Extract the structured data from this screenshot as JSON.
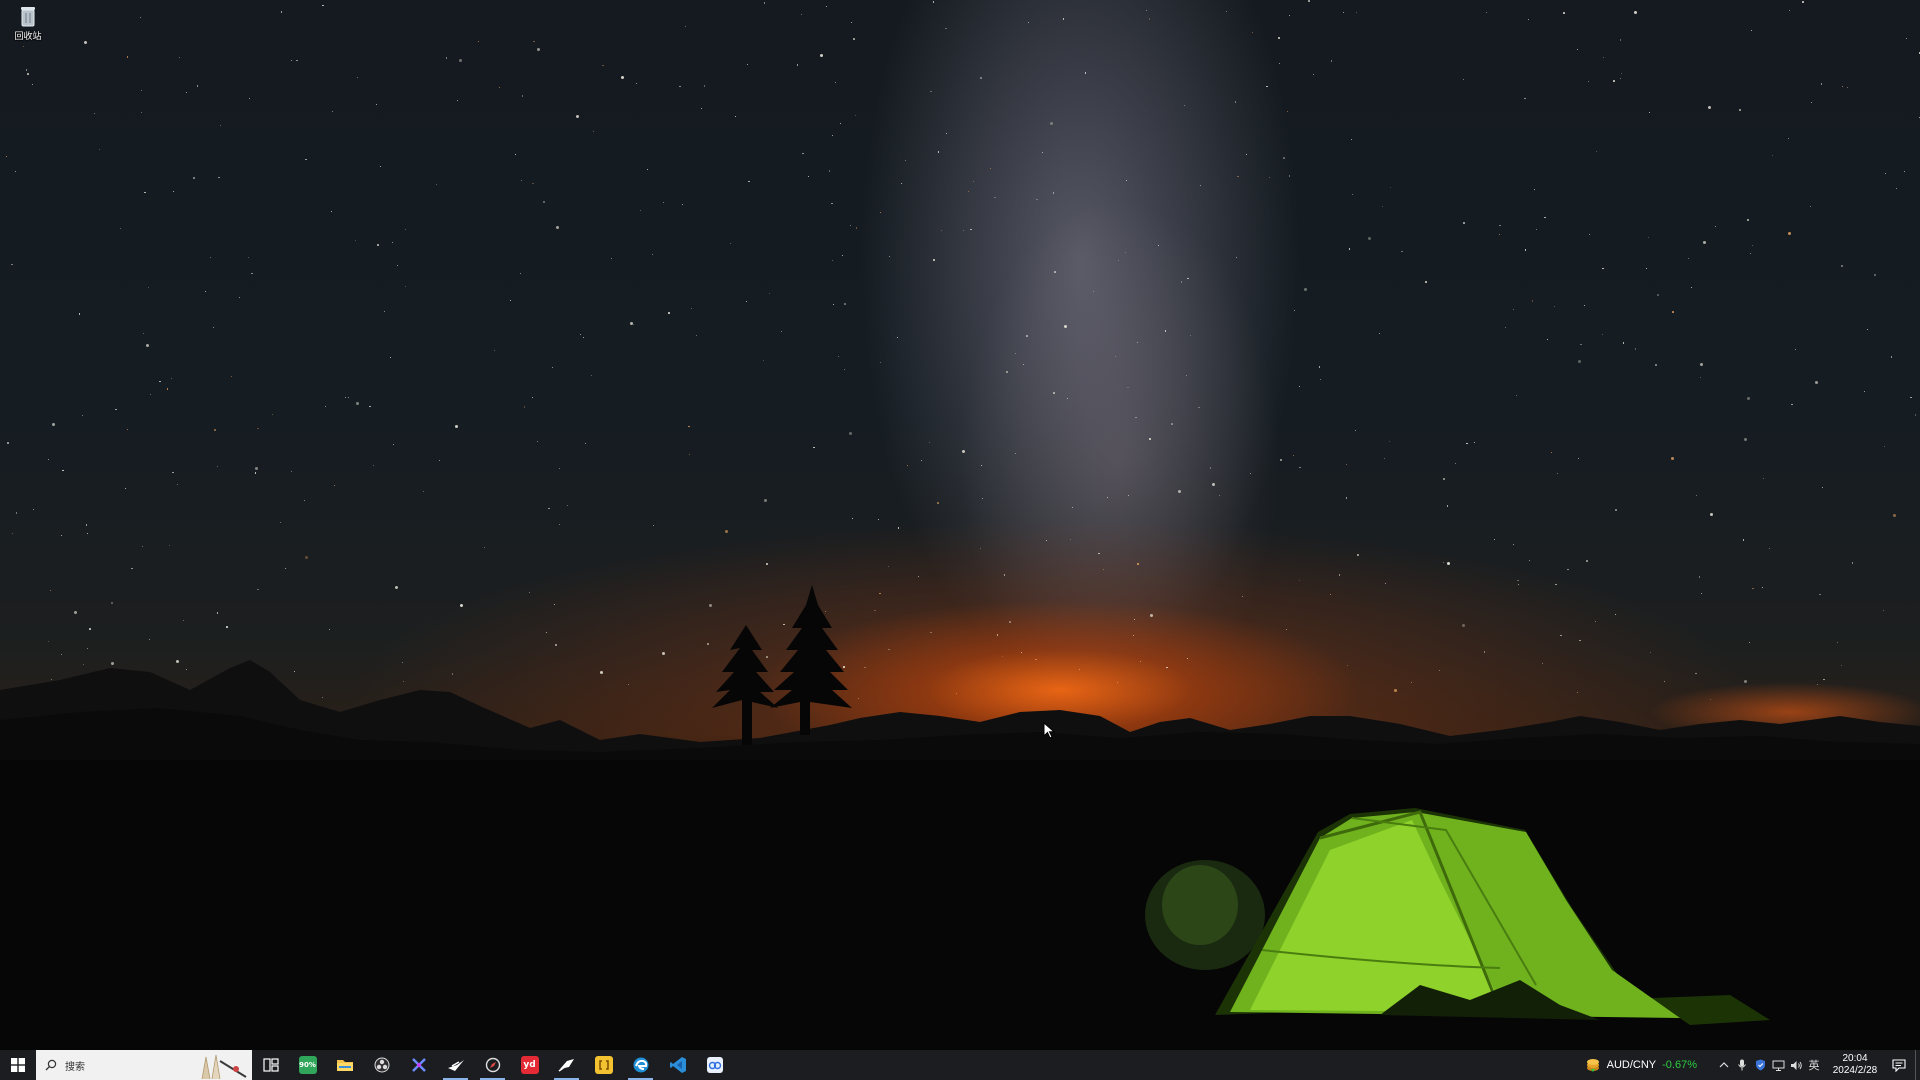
{
  "desktop": {
    "icons": [
      {
        "label": "回收站",
        "icon": "recycle-bin-icon"
      }
    ]
  },
  "taskbar": {
    "search": {
      "placeholder": "搜索"
    },
    "apps": [
      {
        "name": "task-view",
        "icon": "task-view-icon",
        "running": false
      },
      {
        "name": "monitor-app",
        "icon": "monitor-icon",
        "label": "90%",
        "color": "#2fa65a",
        "running": false
      },
      {
        "name": "file-explorer",
        "icon": "folder-icon",
        "color": "#f3c24c",
        "running": false
      },
      {
        "name": "obs",
        "icon": "obs-icon",
        "running": false
      },
      {
        "name": "dev-tool",
        "icon": "cross-tools-icon",
        "color": "#3a5bd9",
        "running": false
      },
      {
        "name": "steam",
        "icon": "steam-icon",
        "running": true
      },
      {
        "name": "browser-app",
        "icon": "compass-browser-icon",
        "running": true
      },
      {
        "name": "youdao-dict",
        "icon": "youdao-icon",
        "label": "yd",
        "color": "#e32a35",
        "running": false
      },
      {
        "name": "feishu",
        "icon": "feishu-icon",
        "running": true
      },
      {
        "name": "notes-app",
        "icon": "notes-icon",
        "color": "#f2c230",
        "running": false
      },
      {
        "name": "edge",
        "icon": "edge-icon",
        "color": "#1f8fd6",
        "running": true
      },
      {
        "name": "vscode",
        "icon": "vscode-icon",
        "color": "#2a8ed8",
        "running": false
      },
      {
        "name": "baidu-netdisk",
        "icon": "cloud-disk-icon",
        "color": "#e9f1ff",
        "running": false
      }
    ],
    "tray": {
      "ticker": {
        "pair": "AUD/CNY",
        "change": "-0.67%",
        "change_color": "#2ecc40"
      },
      "icons": [
        "chevron-up-icon",
        "microphone-icon",
        "shield-icon",
        "network-icon",
        "volume-icon"
      ],
      "ime": "英",
      "clock": {
        "time": "20:04",
        "date": "2024/2/28"
      }
    }
  }
}
